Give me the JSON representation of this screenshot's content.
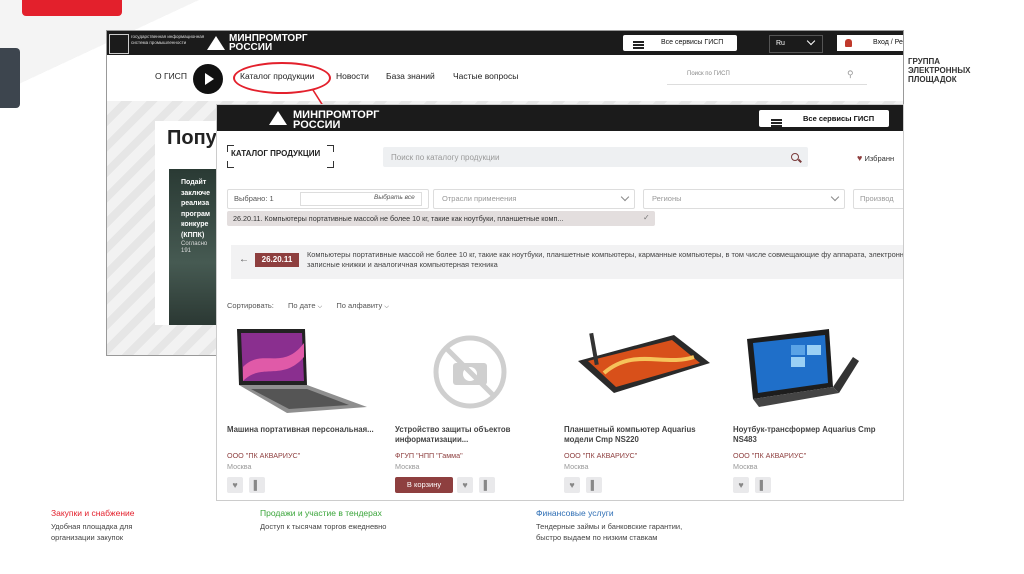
{
  "slide": {
    "brand_caption": [
      "ГРУППА",
      "ЭЛЕКТРОННЫХ",
      "ПЛОЩАДОК"
    ],
    "accent_color": "#e3202c"
  },
  "back_site": {
    "gisp_logo_text": "государственная информационная система промышленности",
    "mpt_logo": [
      "МИНПРОМТОРГ",
      "РОССИИ"
    ],
    "services_button": "Все сервисы ГИСП",
    "language": "Ru",
    "login": "Вход / Ре",
    "nav": [
      "О ГИСП",
      "Каталог продукции",
      "Новости",
      "База знаний",
      "Частые вопросы"
    ],
    "search_placeholder": "Поиск по ГИСП",
    "banner_title": "Попу",
    "news_lines": [
      "Подайт",
      "заключе",
      "реализа",
      "програм",
      "конкуре",
      "(КППК)"
    ],
    "news_sub": [
      "Согласно",
      "191"
    ]
  },
  "front_site": {
    "mpt_logo": [
      "МИНПРОМТОРГ",
      "РОССИИ"
    ],
    "services_button": "Все сервисы ГИСП",
    "catalog_label": "КАТАЛОГ ПРОДУКЦИИ",
    "search_placeholder": "Поиск по каталогу продукции",
    "favorites": "Избранн",
    "filters": {
      "selected_label": "Выбрано: 1",
      "select_all": "Выбрать все",
      "application": "Отрасли применения",
      "regions": "Регионы",
      "producers": "Производ"
    },
    "chip_text": "26.20.11. Компьютеры портативные массой не более 10 кг, такие как ноутбуки, планшетные комп...",
    "crumb": {
      "code": "26.20.11",
      "text": "Компьютеры портативные массой не более 10 кг, такие как ноутбуки, планшетные компьютеры, карманные компьютеры, в том числе совмещающие фу аппарата, электронные записные книжки и аналогичная компьютерная техника"
    },
    "sort": {
      "label": "Сортировать:",
      "by_date": "По дате",
      "by_alpha": "По алфавиту"
    },
    "products": [
      {
        "title": "Машина портативная персональная...",
        "vendor": "ООО \"ПК АКВАРИУС\"",
        "city": "Москва",
        "image": "laptop"
      },
      {
        "title": "Устройство защиты объектов информатизации...",
        "vendor": "ФГУП \"НПП \"Гамма\"",
        "city": "Москва",
        "image": "no-photo",
        "cart_button": "В корзину"
      },
      {
        "title": "Планшетный компьютер Aquarius модели Cmp NS220",
        "vendor": "ООО \"ПК АКВАРИУС\"",
        "city": "Москва",
        "image": "tablet"
      },
      {
        "title": "Ноутбук-трансформер Aquarius Cmp NS483",
        "vendor": "ООО \"ПК АКВАРИУС\"",
        "city": "Москва",
        "image": "convertible"
      }
    ]
  },
  "footer": [
    {
      "title": "Закупки и снабжение",
      "text": [
        "Удобная площадка для",
        "организации закупок"
      ],
      "color": "#e3202c"
    },
    {
      "title": "Продажи и участие в тендерах",
      "text": [
        "Доступ к тысячам торгов ежедневно"
      ],
      "color": "#3aa53a"
    },
    {
      "title": "Финансовые услуги",
      "text": [
        "Тендерные займы и банковские гарантии,",
        "быстро выдаем по низким ставкам"
      ],
      "color": "#2f6fb5"
    }
  ]
}
